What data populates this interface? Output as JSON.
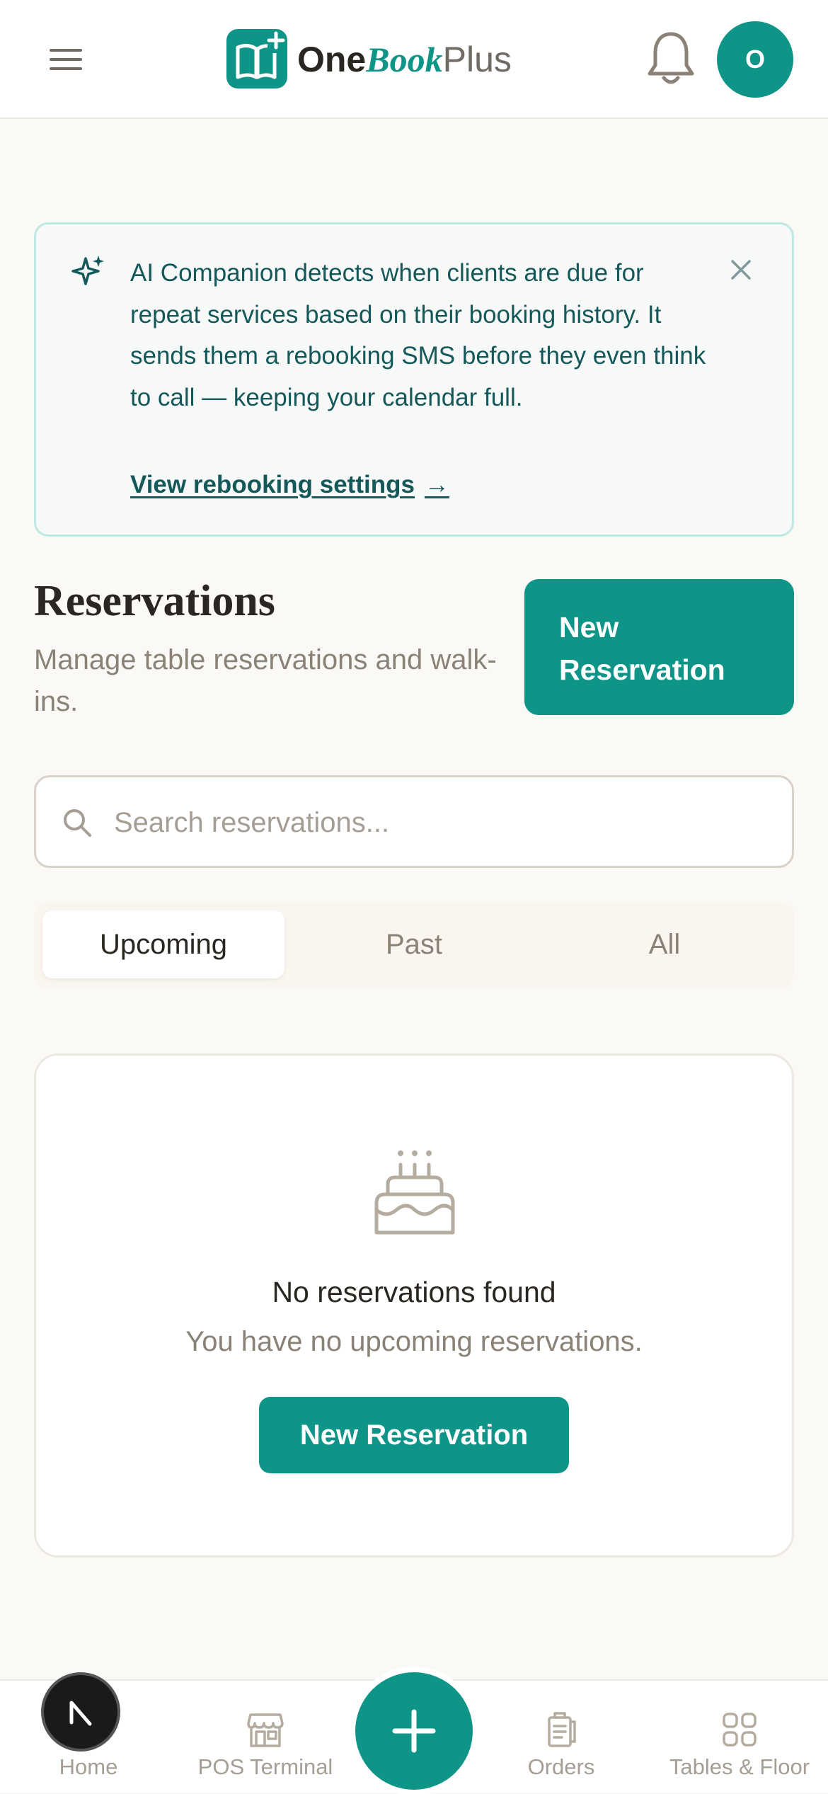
{
  "header": {
    "logo": {
      "one": "One",
      "book": "Book",
      "plus": "Plus"
    },
    "avatar_initial": "O"
  },
  "ai_banner": {
    "text": "AI Companion detects when clients are due for repeat services based on their booking history. It sends them a rebooking SMS before they even think to call — keeping your calendar full.",
    "link_label": "View rebooking settings",
    "link_arrow": "→"
  },
  "page": {
    "title": "Reservations",
    "subtitle": "Manage table reservations and walk-ins.",
    "new_button_label": "New Reservation"
  },
  "search": {
    "placeholder": "Search reservations...",
    "value": ""
  },
  "tabs": [
    {
      "label": "Upcoming",
      "active": true
    },
    {
      "label": "Past",
      "active": false
    },
    {
      "label": "All",
      "active": false
    }
  ],
  "empty_state": {
    "icon": "cake-icon",
    "title": "No reservations found",
    "subtitle": "You have no upcoming reservations.",
    "button_label": "New Reservation"
  },
  "bottom_nav": {
    "items": [
      {
        "label": "Home",
        "icon": "home-icon"
      },
      {
        "label": "POS Terminal",
        "icon": "store-icon"
      },
      {
        "label": "Orders",
        "icon": "clipboard-icon"
      },
      {
        "label": "Tables & Floor",
        "icon": "grid-icon"
      }
    ],
    "fab_icon": "plus-icon"
  },
  "colors": {
    "accent": "#0f9488",
    "background": "#fbf9f6",
    "banner_bg": "#f7f9f8",
    "banner_border": "#bde9e2",
    "muted_text": "#8a8277"
  }
}
